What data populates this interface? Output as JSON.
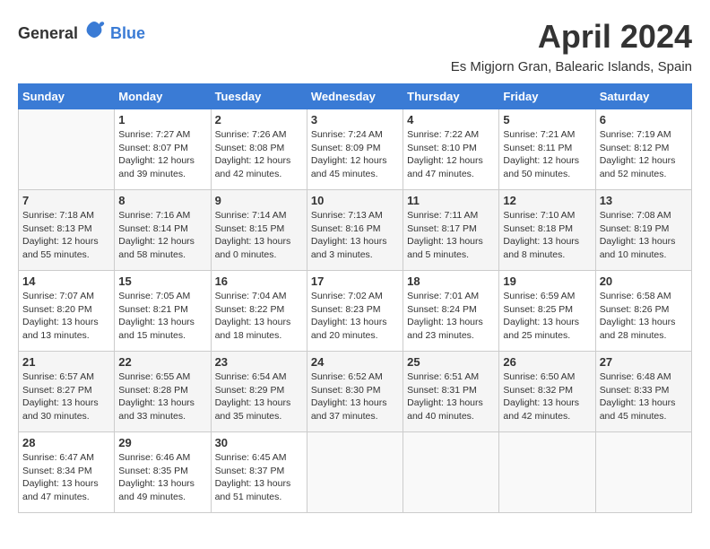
{
  "header": {
    "logo_general": "General",
    "logo_blue": "Blue",
    "month_year": "April 2024",
    "location": "Es Migjorn Gran, Balearic Islands, Spain"
  },
  "days_of_week": [
    "Sunday",
    "Monday",
    "Tuesday",
    "Wednesday",
    "Thursday",
    "Friday",
    "Saturday"
  ],
  "weeks": [
    [
      {
        "day": "",
        "info": ""
      },
      {
        "day": "1",
        "info": "Sunrise: 7:27 AM\nSunset: 8:07 PM\nDaylight: 12 hours\nand 39 minutes."
      },
      {
        "day": "2",
        "info": "Sunrise: 7:26 AM\nSunset: 8:08 PM\nDaylight: 12 hours\nand 42 minutes."
      },
      {
        "day": "3",
        "info": "Sunrise: 7:24 AM\nSunset: 8:09 PM\nDaylight: 12 hours\nand 45 minutes."
      },
      {
        "day": "4",
        "info": "Sunrise: 7:22 AM\nSunset: 8:10 PM\nDaylight: 12 hours\nand 47 minutes."
      },
      {
        "day": "5",
        "info": "Sunrise: 7:21 AM\nSunset: 8:11 PM\nDaylight: 12 hours\nand 50 minutes."
      },
      {
        "day": "6",
        "info": "Sunrise: 7:19 AM\nSunset: 8:12 PM\nDaylight: 12 hours\nand 52 minutes."
      }
    ],
    [
      {
        "day": "7",
        "info": "Sunrise: 7:18 AM\nSunset: 8:13 PM\nDaylight: 12 hours\nand 55 minutes."
      },
      {
        "day": "8",
        "info": "Sunrise: 7:16 AM\nSunset: 8:14 PM\nDaylight: 12 hours\nand 58 minutes."
      },
      {
        "day": "9",
        "info": "Sunrise: 7:14 AM\nSunset: 8:15 PM\nDaylight: 13 hours\nand 0 minutes."
      },
      {
        "day": "10",
        "info": "Sunrise: 7:13 AM\nSunset: 8:16 PM\nDaylight: 13 hours\nand 3 minutes."
      },
      {
        "day": "11",
        "info": "Sunrise: 7:11 AM\nSunset: 8:17 PM\nDaylight: 13 hours\nand 5 minutes."
      },
      {
        "day": "12",
        "info": "Sunrise: 7:10 AM\nSunset: 8:18 PM\nDaylight: 13 hours\nand 8 minutes."
      },
      {
        "day": "13",
        "info": "Sunrise: 7:08 AM\nSunset: 8:19 PM\nDaylight: 13 hours\nand 10 minutes."
      }
    ],
    [
      {
        "day": "14",
        "info": "Sunrise: 7:07 AM\nSunset: 8:20 PM\nDaylight: 13 hours\nand 13 minutes."
      },
      {
        "day": "15",
        "info": "Sunrise: 7:05 AM\nSunset: 8:21 PM\nDaylight: 13 hours\nand 15 minutes."
      },
      {
        "day": "16",
        "info": "Sunrise: 7:04 AM\nSunset: 8:22 PM\nDaylight: 13 hours\nand 18 minutes."
      },
      {
        "day": "17",
        "info": "Sunrise: 7:02 AM\nSunset: 8:23 PM\nDaylight: 13 hours\nand 20 minutes."
      },
      {
        "day": "18",
        "info": "Sunrise: 7:01 AM\nSunset: 8:24 PM\nDaylight: 13 hours\nand 23 minutes."
      },
      {
        "day": "19",
        "info": "Sunrise: 6:59 AM\nSunset: 8:25 PM\nDaylight: 13 hours\nand 25 minutes."
      },
      {
        "day": "20",
        "info": "Sunrise: 6:58 AM\nSunset: 8:26 PM\nDaylight: 13 hours\nand 28 minutes."
      }
    ],
    [
      {
        "day": "21",
        "info": "Sunrise: 6:57 AM\nSunset: 8:27 PM\nDaylight: 13 hours\nand 30 minutes."
      },
      {
        "day": "22",
        "info": "Sunrise: 6:55 AM\nSunset: 8:28 PM\nDaylight: 13 hours\nand 33 minutes."
      },
      {
        "day": "23",
        "info": "Sunrise: 6:54 AM\nSunset: 8:29 PM\nDaylight: 13 hours\nand 35 minutes."
      },
      {
        "day": "24",
        "info": "Sunrise: 6:52 AM\nSunset: 8:30 PM\nDaylight: 13 hours\nand 37 minutes."
      },
      {
        "day": "25",
        "info": "Sunrise: 6:51 AM\nSunset: 8:31 PM\nDaylight: 13 hours\nand 40 minutes."
      },
      {
        "day": "26",
        "info": "Sunrise: 6:50 AM\nSunset: 8:32 PM\nDaylight: 13 hours\nand 42 minutes."
      },
      {
        "day": "27",
        "info": "Sunrise: 6:48 AM\nSunset: 8:33 PM\nDaylight: 13 hours\nand 45 minutes."
      }
    ],
    [
      {
        "day": "28",
        "info": "Sunrise: 6:47 AM\nSunset: 8:34 PM\nDaylight: 13 hours\nand 47 minutes."
      },
      {
        "day": "29",
        "info": "Sunrise: 6:46 AM\nSunset: 8:35 PM\nDaylight: 13 hours\nand 49 minutes."
      },
      {
        "day": "30",
        "info": "Sunrise: 6:45 AM\nSunset: 8:37 PM\nDaylight: 13 hours\nand 51 minutes."
      },
      {
        "day": "",
        "info": ""
      },
      {
        "day": "",
        "info": ""
      },
      {
        "day": "",
        "info": ""
      },
      {
        "day": "",
        "info": ""
      }
    ]
  ]
}
